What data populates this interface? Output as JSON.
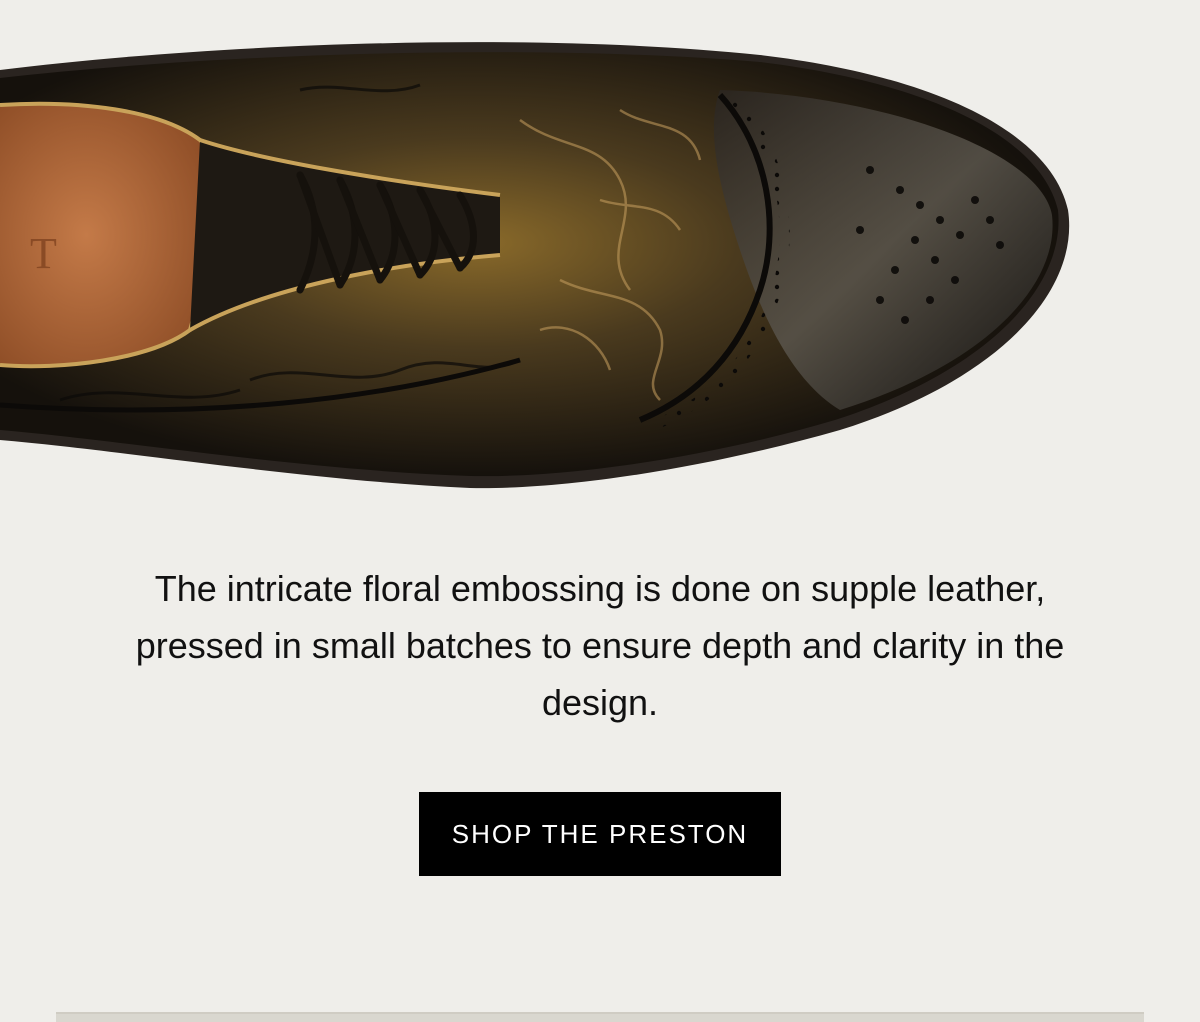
{
  "hero": {
    "image_label": "Embossed leather wingtip oxford shoe, top view",
    "insole_mark": "T"
  },
  "body_text": "The intricate floral embossing is done on supple leather, pressed in small batches to ensure depth and clarity in the design.",
  "cta": {
    "label": "SHOP THE PRESTON"
  },
  "colors": {
    "background": "#efeeea",
    "button": "#000000",
    "button_text": "#ffffff",
    "text": "#111111",
    "leather_dark": "#1a1510",
    "leather_bronze": "#8a6a2a",
    "lining": "#b46a3c"
  }
}
